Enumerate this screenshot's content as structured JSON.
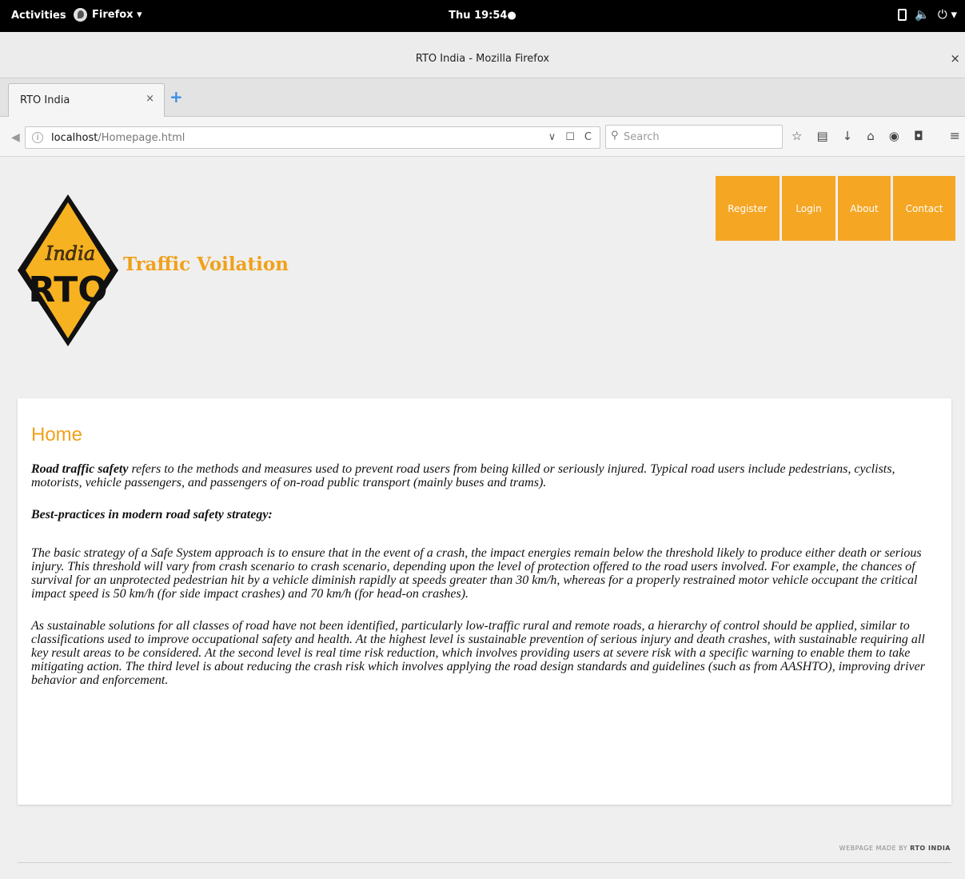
{
  "system": {
    "activities": "Activities",
    "app_menu": "Firefox ▾",
    "clock": "Thu 19:54●",
    "tray": {
      "sound": "🔈",
      "power": "⏻ ▾"
    }
  },
  "window": {
    "title": "RTO India - Mozilla Firefox",
    "close": "×"
  },
  "tabs": [
    {
      "title": "RTO India",
      "close": "×"
    }
  ],
  "new_tab": "+",
  "urlbar": {
    "host": "localhost",
    "path": "/Homepage.html",
    "info": "i",
    "dropdown": "∨",
    "reader": "☐",
    "reload": "C"
  },
  "search": {
    "placeholder": "Search",
    "icon": "⚲"
  },
  "toolbar_icons": {
    "bookmark": "☆",
    "library": "▤",
    "downloads": "↓",
    "home": "⌂",
    "sync": "◉",
    "pocket": "◘",
    "menu": "≡",
    "back": "◀"
  },
  "site": {
    "logo_text_top": "India",
    "logo_text_main": "RTO",
    "brand": "Traffic Voilation",
    "nav": [
      "Register",
      "Login",
      "About",
      "Contact"
    ]
  },
  "main": {
    "heading": "Home",
    "intro_bold": "Road traffic safety",
    "intro_rest": " refers to the methods and measures used to prevent road users from being killed or seriously injured. Typical road users include pedestrians, cyclists, motorists, vehicle passengers, and passengers of on-road public transport (mainly buses and trams).",
    "subheading": "Best-practices in modern road safety strategy:",
    "para2": "The basic strategy of a Safe System approach is to ensure that in the event of a crash, the impact energies remain below the threshold likely to produce either death or serious injury. This threshold will vary from crash scenario to crash scenario, depending upon the level of protection offered to the road users involved. For example, the chances of survival for an unprotected pedestrian hit by a vehicle diminish rapidly at speeds greater than 30 km/h, whereas for a properly restrained motor vehicle occupant the critical impact speed is 50 km/h (for side impact crashes) and 70 km/h (for head-on crashes).",
    "para3": "As sustainable solutions for all classes of road have not been identified, particularly low-traffic rural and remote roads, a hierarchy of control should be applied, similar to classifications used to improve occupational safety and health. At the highest level is sustainable prevention of serious injury and death crashes, with sustainable requiring all key result areas to be considered. At the second level is real time risk reduction, which involves providing users at severe risk with a specific warning to enable them to take mitigating action. The third level is about reducing the crash risk which involves applying the road design standards and guidelines (such as from AASHTO), improving driver behavior and enforcement."
  },
  "footer": {
    "made_by": "WEBPAGE MADE BY ",
    "author": "RTO INDIA"
  },
  "colors": {
    "accent": "#f5a623",
    "heading": "#f0a11b",
    "logo_fill": "#f6b220"
  }
}
